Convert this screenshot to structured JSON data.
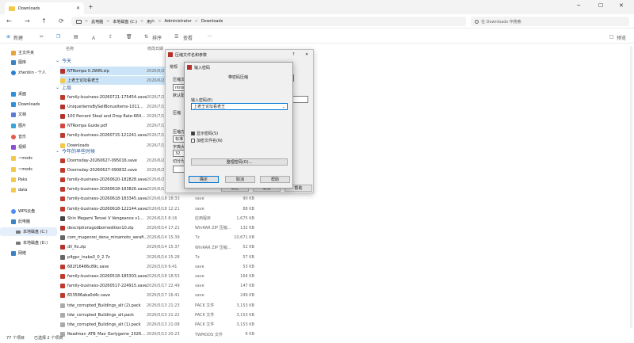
{
  "window": {
    "tab_title": "Downloads",
    "new_tab": "+",
    "min": "─",
    "max": "☐",
    "close": "✕"
  },
  "nav": {
    "back": "←",
    "forward": "→",
    "up": "↑",
    "refresh": "⟳"
  },
  "address": {
    "segments": [
      "此电脑",
      "本地磁盘 (C:)",
      "用户",
      "Administrator",
      "Downloads"
    ],
    "separator": ">"
  },
  "search": {
    "placeholder": "在 Downloads 中搜索"
  },
  "toolbar": {
    "new": "新建",
    "sort": "排序",
    "view": "查看",
    "more": "···",
    "preview": "预览"
  },
  "sidebar": [
    {
      "label": "主文件夹",
      "color": "#e8a33d"
    },
    {
      "label": "图库",
      "color": "#3b82c4"
    },
    {
      "label": "zhenbin - 个人",
      "color": "#2a7fd4"
    },
    {
      "label": "桌面",
      "color": "#2f8fd8"
    },
    {
      "label": "Downloads",
      "color": "#2f8fd8"
    },
    {
      "label": "文档",
      "color": "#5b7bd5"
    },
    {
      "label": "图片",
      "color": "#3ba3d8"
    },
    {
      "label": "音乐",
      "color": "#e35b4c"
    },
    {
      "label": "视频",
      "color": "#8c4fd3"
    },
    {
      "label": "~mods",
      "color": "#f2c94c"
    },
    {
      "label": "~mods",
      "color": "#f2c94c"
    },
    {
      "label": "Paks",
      "color": "#f2c94c"
    },
    {
      "label": "data",
      "color": "#f2c94c"
    },
    {
      "label": "WPS云盘",
      "color": "#4c8ef5"
    },
    {
      "label": "此电脑",
      "color": "#3b82c4"
    },
    {
      "label": "本地磁盘 (C:)",
      "color": "#777777"
    },
    {
      "label": "本地磁盘 (D:)",
      "color": "#777777"
    },
    {
      "label": "网络",
      "color": "#3b82c4"
    }
  ],
  "headers": {
    "name": "名称",
    "date": "修改日期"
  },
  "groups": {
    "today": "今天",
    "lastweek": "上周",
    "earlier": "今年的早些时候"
  },
  "files_today": [
    {
      "name": "NTRompa 0.2WIN.zip",
      "date": "2026/6/2",
      "type": "",
      "size": "",
      "color": "#b5312b"
    },
    {
      "name": "上老王论坛看老王",
      "date": "2026/6/2",
      "type": "",
      "size": "",
      "color": "#f2c94c"
    }
  ],
  "files_lastweek": [
    {
      "name": "family-business-20260721-175454.save",
      "date": "2026/7/2",
      "type": "",
      "size": "",
      "color": "#c0392b"
    },
    {
      "name": "UniquetiemsBySellBonusItems-1011...",
      "date": "2026/7/1",
      "type": "",
      "size": "",
      "color": "#b5312b"
    },
    {
      "name": "100 Percent Steal and Drop Rate-664...",
      "date": "2026/7/1",
      "type": "",
      "size": "",
      "color": "#b5312b"
    },
    {
      "name": "NTRompa Guide.pdf",
      "date": "2026/7/1",
      "type": "",
      "size": "",
      "color": "#d64541"
    },
    {
      "name": "family-business-20260715-121241.save",
      "date": "2026/7/1",
      "type": "",
      "size": "",
      "color": "#c0392b"
    },
    {
      "name": "Downloads",
      "date": "2026/7/1",
      "type": "",
      "size": "",
      "color": "#f2c94c"
    }
  ],
  "files_earlier": [
    {
      "name": "Doomsday-20260627-095016.save",
      "date": "2026/6/2",
      "type": "",
      "size": "",
      "color": "#c0392b"
    },
    {
      "name": "Doomsday-20260627-090832.save",
      "date": "2026/6/2",
      "type": "",
      "size": "",
      "color": "#c0392b"
    },
    {
      "name": "family-business-20260620-182828.save",
      "date": "2026/6/2",
      "type": "",
      "size": "",
      "color": "#c0392b"
    },
    {
      "name": "family-business-20260618-183826.save",
      "date": "2026/6/1",
      "type": "",
      "size": "",
      "color": "#c0392b"
    },
    {
      "name": "family-business-20260618-183345.save",
      "date": "2026/6/18 18:33",
      "type": "save",
      "size": "90 KB",
      "color": "#c0392b"
    },
    {
      "name": "family-business-20260618-122144.save",
      "date": "2026/6/18 12:21",
      "type": "save",
      "size": "88 KB",
      "color": "#c0392b"
    },
    {
      "name": "Shin Megami Tensei V Vengeance v1...",
      "date": "2026/6/15 8:16",
      "type": "应用程序",
      "size": "1,675 KB",
      "color": "#444444"
    },
    {
      "name": "descriptionsgodbornedition10.zip",
      "date": "2026/6/14 17:21",
      "type": "WinRAR ZIP 压缩...",
      "size": "132 KB",
      "color": "#b5312b"
    },
    {
      "name": "com_mugenrei_dena_minamoto_serafi...",
      "date": "2026/6/14 15:39",
      "type": "7z",
      "size": "10,671 KB",
      "color": "#666666"
    },
    {
      "name": "dll_fix.zip",
      "date": "2026/6/14 15:37",
      "type": "WinRAR ZIP 压缩...",
      "size": "52 KB",
      "color": "#b5312b"
    },
    {
      "name": "p4gpc_inaba3_0_2.7z",
      "date": "2026/6/14 15:28",
      "type": "7z",
      "size": "57 KB",
      "color": "#666666"
    },
    {
      "name": "682f16486c89c.save",
      "date": "2026/5/19 9:41",
      "type": "save",
      "size": "53 KB",
      "color": "#c0392b"
    },
    {
      "name": "family-business-20260518-185303.save",
      "date": "2026/5/18 18:53",
      "type": "save",
      "size": "164 KB",
      "color": "#c0392b"
    },
    {
      "name": "family-business-20260517-224915.save",
      "date": "2026/5/17 22:49",
      "type": "save",
      "size": "147 KB",
      "color": "#c0392b"
    },
    {
      "name": "653586aba0d4c.save",
      "date": "2026/5/17 16:41",
      "type": "save",
      "size": "249 KB",
      "color": "#c0392b"
    },
    {
      "name": "tdw_corrupted_Buildings_alt (2).pack",
      "date": "2026/5/13 21:23",
      "type": "PACK 文件",
      "size": "3,153 KB",
      "color": "#aaaaaa"
    },
    {
      "name": "tdw_corrupted_Buildings_alt.pack",
      "date": "2026/5/13 21:22",
      "type": "PACK 文件",
      "size": "3,153 KB",
      "color": "#aaaaaa"
    },
    {
      "name": "tdw_corrupted_Buildings_alt (1).pack",
      "date": "2026/5/13 21:08",
      "type": "PACK 文件",
      "size": "3,153 KB",
      "color": "#aaaaaa"
    },
    {
      "name": "Readman_ATB_Mao_Earlygame_2026...",
      "date": "2026/5/13 20:23",
      "type": "TWMODS 文件",
      "size": "6 KB",
      "color": "#aaaaaa"
    }
  ],
  "status": {
    "count": "77 个项目",
    "selected": "已选择 2 个项目"
  },
  "archive_dialog": {
    "title": "压缩文件名和参数",
    "tab_general": "常规",
    "lbl_archive": "压缩文",
    "archive_name": "ntromp",
    "lbl_default": "默认配",
    "lbl_format": "压缩",
    "lbl_method": "压缩方",
    "method_value": "标准",
    "lbl_dict": "字典大",
    "dict_value": "32",
    "lbl_split": "切分为",
    "ok": "确定",
    "cancel": "取消",
    "help": "帮助"
  },
  "pw_dialog": {
    "title": "输入密码",
    "heading": "带密码压缩",
    "label": "输入密码(E)",
    "value": "上老王论坛看老王",
    "show_pw": "显示密码(S)",
    "encrypt_names": "加密文件名(N)",
    "organize": "整理密码(O)...",
    "ok": "确定",
    "cancel": "取消",
    "help": "帮助"
  }
}
